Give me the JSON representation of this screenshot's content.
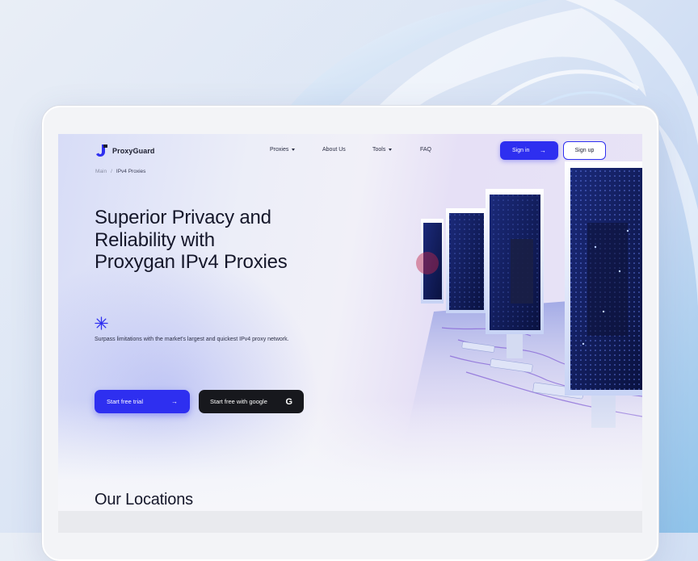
{
  "brand": {
    "name": "ProxyGuard"
  },
  "nav": {
    "items": [
      {
        "label": "Proxies",
        "has_dropdown": true
      },
      {
        "label": "About Us",
        "has_dropdown": false
      },
      {
        "label": "Tools",
        "has_dropdown": true
      },
      {
        "label": "FAQ",
        "has_dropdown": false
      }
    ],
    "signin_label": "Sign in",
    "signup_label": "Sign up"
  },
  "breadcrumb": {
    "root": "Main",
    "separator": "/",
    "current": "IPv4 Proxies"
  },
  "hero": {
    "title_lines": [
      "Superior Privacy and",
      "Reliability with",
      "Proxygan IPv4 Proxies"
    ],
    "subtitle": "Surpass limitations with the market's largest and quickest IPv4 proxy network.",
    "cta_trial": "Start free trial",
    "cta_google": "Start free with google",
    "google_icon_glyph": "G"
  },
  "sections": {
    "locations_title": "Our Locations"
  },
  "icons": {
    "arrow": "arrow-right-icon",
    "sparkle": "sparkle-icon",
    "google": "google-icon",
    "logo": "proxyguard-logo-icon"
  },
  "colors": {
    "accent": "#2e2ff0",
    "dark_button": "#17181d",
    "text": "#15172a"
  }
}
